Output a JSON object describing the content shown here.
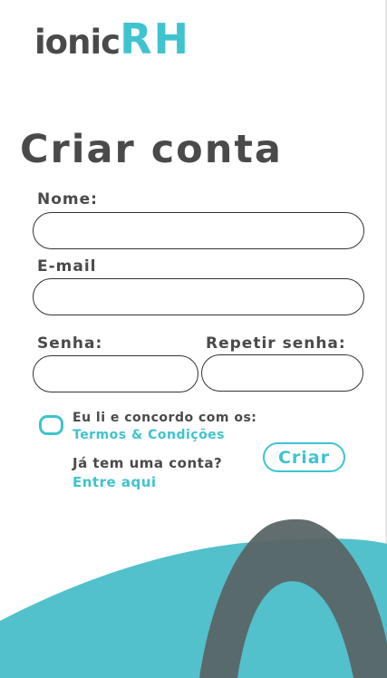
{
  "logo": {
    "part1": "ionic",
    "part2": "RH"
  },
  "page_title": "Criar conta",
  "form": {
    "name_label": "Nome:",
    "name_value": "",
    "email_label": "E-mail",
    "email_value": "",
    "password_label": "Senha:",
    "password_value": "",
    "repeat_password_label": "Repetir senha:",
    "repeat_password_value": ""
  },
  "terms": {
    "checked": false,
    "text": "Eu li e concordo com os:",
    "link": "Termos & Condições"
  },
  "login_prompt": {
    "text": "Já tem uma conta?",
    "link": "Entre aqui"
  },
  "submit_label": "Criar",
  "colors": {
    "accent": "#3fc3cf",
    "text": "#4a4a4a",
    "wave": "#52c1cc",
    "arch": "#5a6567"
  }
}
